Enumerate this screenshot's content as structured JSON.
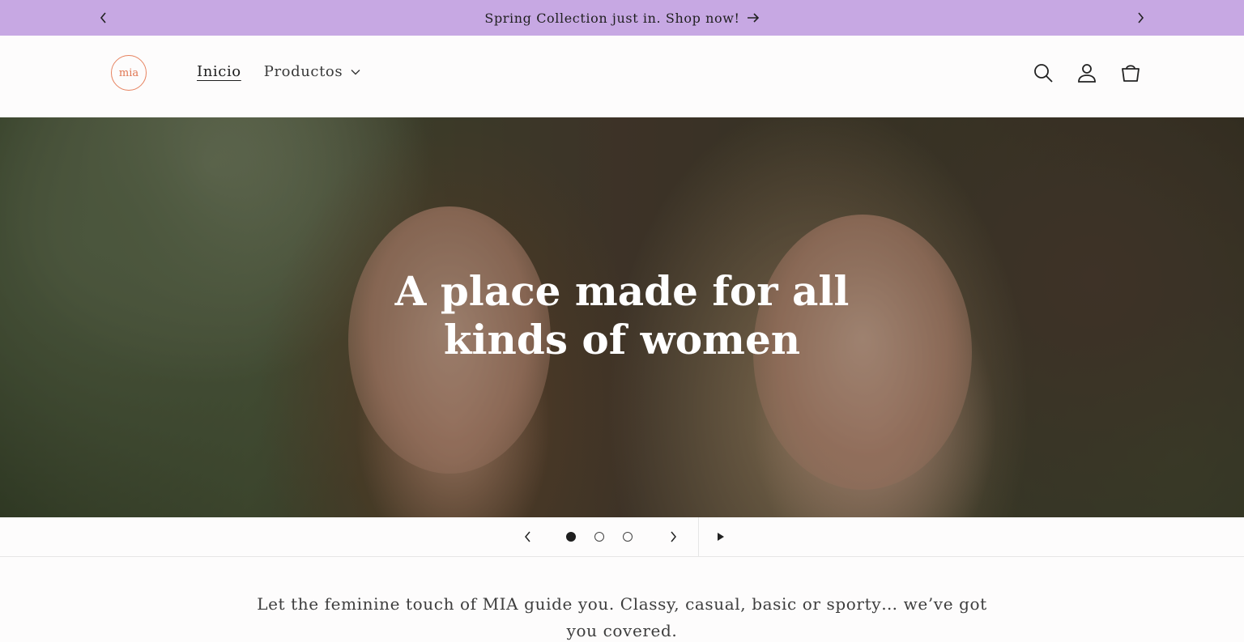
{
  "announcement": {
    "message": "Spring Collection just in. Shop now!",
    "arrow_icon": "arrow-right-icon"
  },
  "header": {
    "logo_text": "mia",
    "nav": [
      {
        "label": "Inicio",
        "active": true
      },
      {
        "label": "Productos",
        "has_dropdown": true
      }
    ],
    "icons": [
      "search-icon",
      "account-icon",
      "cart-icon"
    ]
  },
  "hero": {
    "title_line1": "A place made for all",
    "title_line2": "kinds of women"
  },
  "slider": {
    "slides_count": 3,
    "active_slide": 1
  },
  "intro": {
    "text": "Let the feminine touch of MIA guide you. Classy, casual, basic or sporty… we’ve got you covered."
  },
  "colors": {
    "announcement_bg": "#c7a8e3",
    "logo_accent": "#e7825f",
    "page_bg": "#fdfcfc"
  }
}
